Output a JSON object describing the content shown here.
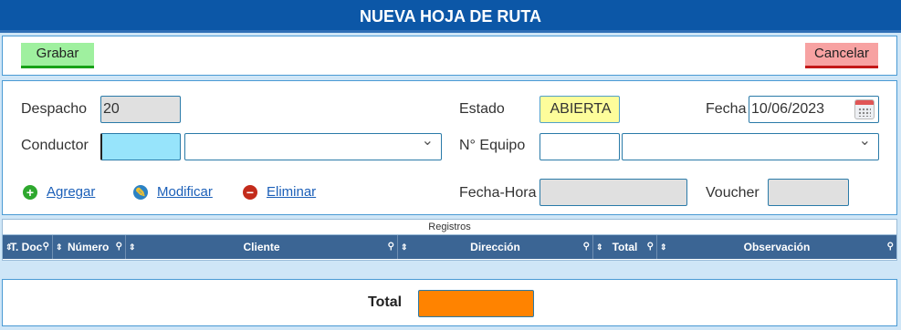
{
  "header": {
    "title": "NUEVA HOJA DE RUTA"
  },
  "toolbar": {
    "save_label": "Grabar",
    "cancel_label": "Cancelar"
  },
  "form": {
    "despacho_label": "Despacho",
    "despacho_value": "20",
    "conductor_label": "Conductor",
    "conductor_code": "",
    "conductor_select": "",
    "estado_label": "Estado",
    "estado_value": "ABIERTA",
    "equipo_label": "N° Equipo",
    "equipo_code": "",
    "equipo_select": "",
    "fecha_label": "Fecha",
    "fecha_value": "10/06/2023",
    "fechahora_label": "Fecha-Hora",
    "fechahora_value": "",
    "voucher_label": "Voucher",
    "voucher_value": ""
  },
  "actions": {
    "add_label": "Agregar",
    "edit_label": "Modificar",
    "delete_label": "Eliminar"
  },
  "grid": {
    "title": "Registros",
    "columns": [
      "T. Doc",
      "Número",
      "Cliente",
      "Dirección",
      "Total",
      "Observación"
    ]
  },
  "totals": {
    "label": "Total",
    "value": ""
  },
  "colors": {
    "header": "#0c57a7",
    "column_header": "#3b6594",
    "save": "#9ff09f",
    "cancel": "#f7a2a2",
    "total_box": "#ff8300"
  }
}
